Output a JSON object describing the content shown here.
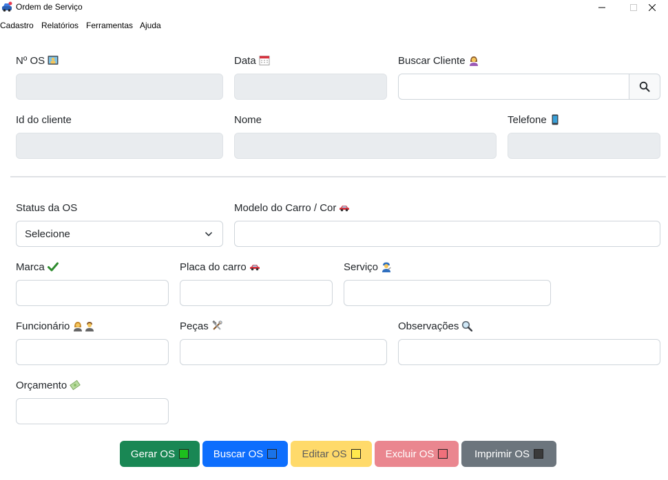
{
  "window": {
    "title": "Ordem de Serviço"
  },
  "menu": [
    "Cadastro",
    "Relatórios",
    "Ferramentas",
    "Ajuda"
  ],
  "form": {
    "os_number": {
      "label": "Nº OS",
      "value": ""
    },
    "date": {
      "label": "Data",
      "value": ""
    },
    "search_client": {
      "label": "Buscar Cliente",
      "value": ""
    },
    "client_id": {
      "label": "Id do cliente",
      "value": ""
    },
    "name": {
      "label": "Nome",
      "value": ""
    },
    "phone": {
      "label": "Telefone",
      "value": ""
    },
    "status": {
      "label": "Status da OS",
      "selected": "Selecione"
    },
    "car_model": {
      "label": "Modelo do Carro / Cor",
      "value": ""
    },
    "brand": {
      "label": "Marca",
      "value": ""
    },
    "plate": {
      "label": "Placa do carro",
      "value": ""
    },
    "service": {
      "label": "Serviço",
      "value": ""
    },
    "employee": {
      "label": "Funcionário",
      "value": ""
    },
    "parts": {
      "label": "Peças",
      "value": ""
    },
    "notes": {
      "label": "Observações",
      "value": ""
    },
    "budget": {
      "label": "Orçamento",
      "value": ""
    }
  },
  "buttons": {
    "generate": {
      "label": "Gerar OS",
      "bg": "#198754",
      "fg": "#ffffff",
      "mark": "#1dbf1d"
    },
    "search": {
      "label": "Buscar OS",
      "bg": "#0d6efd",
      "fg": "#ffffff",
      "mark": "#1a73e8"
    },
    "edit": {
      "label": "Editar OS",
      "bg": "#ffda6a",
      "fg": "#5c5c5c",
      "mark": "#ffe94d"
    },
    "delete": {
      "label": "Excluir OS",
      "bg": "#ea868f",
      "fg": "#ffffff",
      "mark": "#f0707b"
    },
    "print": {
      "label": "Imprimir OS",
      "bg": "#6c757d",
      "fg": "#ffffff",
      "mark": "#3a3a3a"
    }
  }
}
